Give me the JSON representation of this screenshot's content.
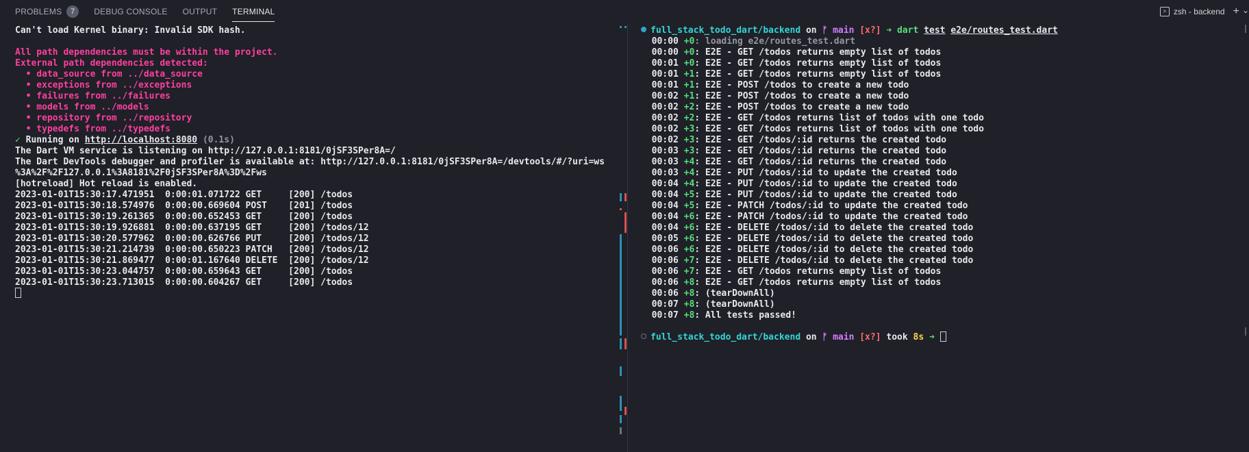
{
  "tabs": {
    "problems": "PROBLEMS",
    "problems_count": "7",
    "debug_console": "DEBUG CONSOLE",
    "output": "OUTPUT",
    "terminal": "TERMINAL"
  },
  "terminal_selector": {
    "label": "zsh - backend",
    "plus": "+",
    "chevron": "⌄"
  },
  "left_terminal": {
    "lines": [
      [
        {
          "t": "Can't load Kernel binary: Invalid SDK hash.",
          "c": "white"
        }
      ],
      [],
      [
        {
          "t": "All path dependencies must be within the project.",
          "c": "pink"
        }
      ],
      [
        {
          "t": "External path dependencies detected:",
          "c": "pink"
        }
      ],
      [
        {
          "t": "  • data_source from ../data_source",
          "c": "pink"
        }
      ],
      [
        {
          "t": "  • exceptions from ../exceptions",
          "c": "pink"
        }
      ],
      [
        {
          "t": "  • failures from ../failures",
          "c": "pink"
        }
      ],
      [
        {
          "t": "  • models from ../models",
          "c": "pink"
        }
      ],
      [
        {
          "t": "  • repository from ../repository",
          "c": "pink"
        }
      ],
      [
        {
          "t": "  • typedefs from ../typedefs",
          "c": "pink"
        }
      ],
      [
        {
          "t": "✓ ",
          "c": "green"
        },
        {
          "t": "Running on ",
          "c": "white"
        },
        {
          "t": "http://localhost:8080",
          "c": "white",
          "u": true
        },
        {
          "t": " (0.1s)",
          "c": "gray"
        }
      ],
      [
        {
          "t": "The Dart VM service is listening on http://127.0.0.1:8181/0jSF3SPer8A=/",
          "c": "white"
        }
      ],
      [
        {
          "t": "The Dart DevTools debugger and profiler is available at: http://127.0.0.1:8181/0jSF3SPer8A=/devtools/#/?uri=ws",
          "c": "white"
        }
      ],
      [
        {
          "t": "%3A%2F%2F127.0.0.1%3A8181%2F0jSF3SPer8A%3D%2Fws",
          "c": "white"
        }
      ],
      [
        {
          "t": "[hotreload] Hot reload is enabled.",
          "c": "white"
        }
      ],
      [
        {
          "t": "2023-01-01T15:30:17.471951  0:00:01.071722 GET     [200] /todos",
          "c": "white"
        }
      ],
      [
        {
          "t": "2023-01-01T15:30:18.574976  0:00:00.669604 POST    [201] /todos",
          "c": "white"
        }
      ],
      [
        {
          "t": "2023-01-01T15:30:19.261365  0:00:00.652453 GET     [200] /todos",
          "c": "white"
        }
      ],
      [
        {
          "t": "2023-01-01T15:30:19.926881  0:00:00.637195 GET     [200] /todos/12",
          "c": "white"
        }
      ],
      [
        {
          "t": "2023-01-01T15:30:20.577962  0:00:00.626766 PUT     [200] /todos/12",
          "c": "white"
        }
      ],
      [
        {
          "t": "2023-01-01T15:30:21.214739  0:00:00.650223 PATCH   [200] /todos/12",
          "c": "white"
        }
      ],
      [
        {
          "t": "2023-01-01T15:30:21.869477  0:00:01.167640 DELETE  [200] /todos/12",
          "c": "white"
        }
      ],
      [
        {
          "t": "2023-01-01T15:30:23.044757  0:00:00.659643 GET     [200] /todos",
          "c": "white"
        }
      ],
      [
        {
          "t": "2023-01-01T15:30:23.713015  0:00:00.604267 GET     [200] /todos",
          "c": "white"
        }
      ],
      [
        {
          "cursor": true
        }
      ]
    ]
  },
  "right_terminal": {
    "lines": [
      [
        {
          "dot": "filled"
        },
        {
          "t": "full_stack_todo_dart/backend",
          "c": "cyan"
        },
        {
          "t": " on ",
          "c": "white"
        },
        {
          "t": "ᚠ main ",
          "c": "magenta"
        },
        {
          "t": "[x?]",
          "c": "red"
        },
        {
          "t": " ➜ ",
          "c": "green"
        },
        {
          "t": "dart ",
          "c": "green"
        },
        {
          "t": "test",
          "c": "white",
          "u": true
        },
        {
          "t": " ",
          "c": "white"
        },
        {
          "t": "e2e/routes_test.dart",
          "c": "white",
          "u": true
        }
      ],
      [
        {
          "t": "  00:00 ",
          "c": "white"
        },
        {
          "t": "+0",
          "c": "green"
        },
        {
          "t": ": loading e2e/routes_test.dart",
          "c": "gray"
        }
      ],
      [
        {
          "t": "  00:00 ",
          "c": "white"
        },
        {
          "t": "+0",
          "c": "green"
        },
        {
          "t": ": E2E - GET /todos returns empty list of todos",
          "c": "white"
        }
      ],
      [
        {
          "t": "  00:01 ",
          "c": "white"
        },
        {
          "t": "+0",
          "c": "green"
        },
        {
          "t": ": E2E - GET /todos returns empty list of todos",
          "c": "white"
        }
      ],
      [
        {
          "t": "  00:01 ",
          "c": "white"
        },
        {
          "t": "+1",
          "c": "green"
        },
        {
          "t": ": E2E - GET /todos returns empty list of todos",
          "c": "white"
        }
      ],
      [
        {
          "t": "  00:01 ",
          "c": "white"
        },
        {
          "t": "+1",
          "c": "green"
        },
        {
          "t": ": E2E - POST /todos to create a new todo",
          "c": "white"
        }
      ],
      [
        {
          "t": "  00:02 ",
          "c": "white"
        },
        {
          "t": "+1",
          "c": "green"
        },
        {
          "t": ": E2E - POST /todos to create a new todo",
          "c": "white"
        }
      ],
      [
        {
          "t": "  00:02 ",
          "c": "white"
        },
        {
          "t": "+2",
          "c": "green"
        },
        {
          "t": ": E2E - POST /todos to create a new todo",
          "c": "white"
        }
      ],
      [
        {
          "t": "  00:02 ",
          "c": "white"
        },
        {
          "t": "+2",
          "c": "green"
        },
        {
          "t": ": E2E - GET /todos returns list of todos with one todo",
          "c": "white"
        }
      ],
      [
        {
          "t": "  00:02 ",
          "c": "white"
        },
        {
          "t": "+3",
          "c": "green"
        },
        {
          "t": ": E2E - GET /todos returns list of todos with one todo",
          "c": "white"
        }
      ],
      [
        {
          "t": "  00:02 ",
          "c": "white"
        },
        {
          "t": "+3",
          "c": "green"
        },
        {
          "t": ": E2E - GET /todos/:id returns the created todo",
          "c": "white"
        }
      ],
      [
        {
          "t": "  00:03 ",
          "c": "white"
        },
        {
          "t": "+3",
          "c": "green"
        },
        {
          "t": ": E2E - GET /todos/:id returns the created todo",
          "c": "white"
        }
      ],
      [
        {
          "t": "  00:03 ",
          "c": "white"
        },
        {
          "t": "+4",
          "c": "green"
        },
        {
          "t": ": E2E - GET /todos/:id returns the created todo",
          "c": "white"
        }
      ],
      [
        {
          "t": "  00:03 ",
          "c": "white"
        },
        {
          "t": "+4",
          "c": "green"
        },
        {
          "t": ": E2E - PUT /todos/:id to update the created todo",
          "c": "white"
        }
      ],
      [
        {
          "t": "  00:04 ",
          "c": "white"
        },
        {
          "t": "+4",
          "c": "green"
        },
        {
          "t": ": E2E - PUT /todos/:id to update the created todo",
          "c": "white"
        }
      ],
      [
        {
          "t": "  00:04 ",
          "c": "white"
        },
        {
          "t": "+5",
          "c": "green"
        },
        {
          "t": ": E2E - PUT /todos/:id to update the created todo",
          "c": "white"
        }
      ],
      [
        {
          "t": "  00:04 ",
          "c": "white"
        },
        {
          "t": "+5",
          "c": "green"
        },
        {
          "t": ": E2E - PATCH /todos/:id to update the created todo",
          "c": "white"
        }
      ],
      [
        {
          "t": "  00:04 ",
          "c": "white"
        },
        {
          "t": "+6",
          "c": "green"
        },
        {
          "t": ": E2E - PATCH /todos/:id to update the created todo",
          "c": "white"
        }
      ],
      [
        {
          "t": "  00:04 ",
          "c": "white"
        },
        {
          "t": "+6",
          "c": "green"
        },
        {
          "t": ": E2E - DELETE /todos/:id to delete the created todo",
          "c": "white"
        }
      ],
      [
        {
          "t": "  00:05 ",
          "c": "white"
        },
        {
          "t": "+6",
          "c": "green"
        },
        {
          "t": ": E2E - DELETE /todos/:id to delete the created todo",
          "c": "white"
        }
      ],
      [
        {
          "t": "  00:06 ",
          "c": "white"
        },
        {
          "t": "+6",
          "c": "green"
        },
        {
          "t": ": E2E - DELETE /todos/:id to delete the created todo",
          "c": "white"
        }
      ],
      [
        {
          "t": "  00:06 ",
          "c": "white"
        },
        {
          "t": "+7",
          "c": "green"
        },
        {
          "t": ": E2E - DELETE /todos/:id to delete the created todo",
          "c": "white"
        }
      ],
      [
        {
          "t": "  00:06 ",
          "c": "white"
        },
        {
          "t": "+7",
          "c": "green"
        },
        {
          "t": ": E2E - GET /todos returns empty list of todos",
          "c": "white"
        }
      ],
      [
        {
          "t": "  00:06 ",
          "c": "white"
        },
        {
          "t": "+8",
          "c": "green"
        },
        {
          "t": ": E2E - GET /todos returns empty list of todos",
          "c": "white"
        }
      ],
      [
        {
          "t": "  00:06 ",
          "c": "white"
        },
        {
          "t": "+8",
          "c": "green"
        },
        {
          "t": ": (tearDownAll)",
          "c": "white"
        }
      ],
      [
        {
          "t": "  00:07 ",
          "c": "white"
        },
        {
          "t": "+8",
          "c": "green"
        },
        {
          "t": ": (tearDownAll)",
          "c": "white"
        }
      ],
      [
        {
          "t": "  00:07 ",
          "c": "white"
        },
        {
          "t": "+8",
          "c": "green"
        },
        {
          "t": ": All tests passed!",
          "c": "white"
        }
      ],
      [],
      [
        {
          "dot": "hollow"
        },
        {
          "t": "full_stack_todo_dart/backend",
          "c": "cyan"
        },
        {
          "t": " on ",
          "c": "white"
        },
        {
          "t": "ᚠ main ",
          "c": "magenta"
        },
        {
          "t": "[x?]",
          "c": "red"
        },
        {
          "t": " took ",
          "c": "white"
        },
        {
          "t": "8s",
          "c": "yellow"
        },
        {
          "t": " ➜ ",
          "c": "green"
        },
        {
          "cursor": true
        }
      ]
    ]
  },
  "colors": {
    "background": "#1f2028",
    "pink": "#ff3f9f",
    "green": "#56e07a",
    "cyan": "#34d5d5",
    "magenta": "#d37dff",
    "red": "#ff6b6b",
    "yellow": "#ffd84a",
    "decoration_blue": "#2e8fb8",
    "decoration_red": "#d9534f"
  }
}
